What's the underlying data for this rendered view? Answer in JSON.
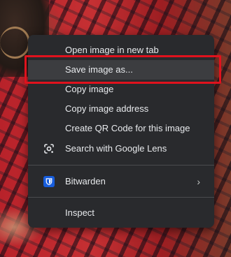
{
  "context_menu": {
    "items": [
      {
        "label": "Open image in new tab"
      },
      {
        "label": "Save image as..."
      },
      {
        "label": "Copy image"
      },
      {
        "label": "Copy image address"
      },
      {
        "label": "Create QR Code for this image"
      },
      {
        "label": "Search with Google Lens",
        "icon": "google-lens-icon"
      },
      {
        "label": "Bitwarden",
        "icon": "bitwarden-icon",
        "submenu_indicator": "›"
      },
      {
        "label": "Inspect"
      }
    ]
  },
  "colors": {
    "menu_background": "#292a2d",
    "hover_background": "#3c3d40",
    "highlight_border": "#e0121d",
    "bitwarden_blue": "#175ddc",
    "text": "#e8eaed"
  }
}
